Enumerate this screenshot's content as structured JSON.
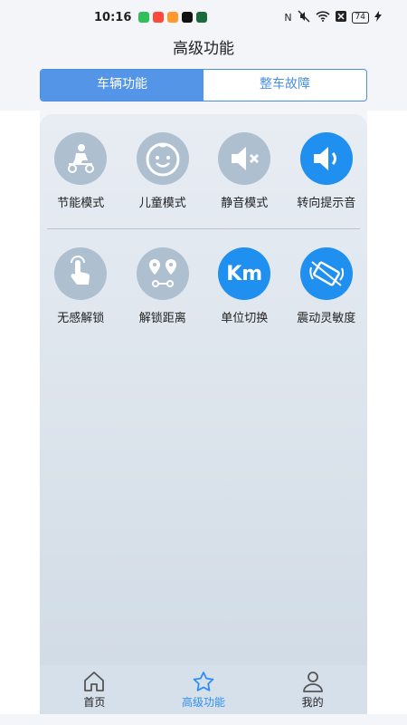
{
  "status_bar": {
    "time": "10:16",
    "battery": "74"
  },
  "header": {
    "title": "高级功能"
  },
  "tabs": [
    {
      "label": "车辆功能",
      "active": true
    },
    {
      "label": "整车故障",
      "active": false
    }
  ],
  "features_row1": [
    {
      "label": "节能模式",
      "icon": "eco-scooter-icon",
      "color": "#aebfcf"
    },
    {
      "label": "儿童模式",
      "icon": "child-face-icon",
      "color": "#aebfcf"
    },
    {
      "label": "静音模式",
      "icon": "mute-speaker-icon",
      "color": "#aebfcf"
    },
    {
      "label": "转向提示音",
      "icon": "speaker-sound-icon",
      "color": "#1f8ff0"
    }
  ],
  "features_row2": [
    {
      "label": "无感解锁",
      "icon": "touch-unlock-icon",
      "color": "#aebfcf"
    },
    {
      "label": "解锁距离",
      "icon": "distance-pins-icon",
      "color": "#aebfcf"
    },
    {
      "label": "单位切换",
      "icon": "km-unit-icon",
      "icon_text": "Km",
      "color": "#1f8ff0"
    },
    {
      "label": "震动灵敏度",
      "icon": "vibration-phone-icon",
      "color": "#1f8ff0"
    }
  ],
  "bottom_nav": [
    {
      "label": "首页",
      "icon": "home-icon",
      "active": false
    },
    {
      "label": "高级功能",
      "icon": "star-icon",
      "active": true
    },
    {
      "label": "我的",
      "icon": "user-icon",
      "active": false
    }
  ],
  "colors": {
    "accent": "#4a90e2",
    "active_icon": "#1f8ff0",
    "inactive_icon": "#aebfcf"
  }
}
